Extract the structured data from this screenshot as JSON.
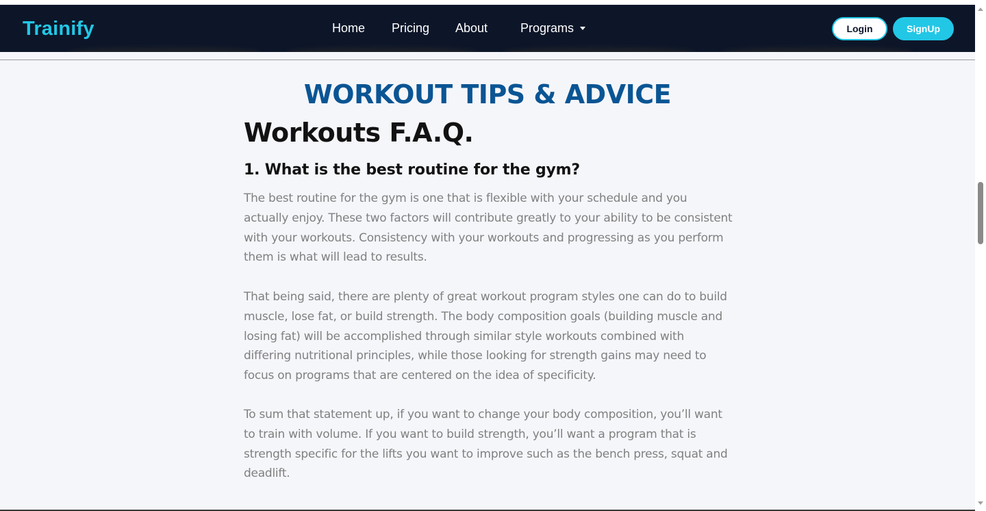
{
  "navbar": {
    "brand": "Trainify",
    "links": [
      {
        "label": "Home"
      },
      {
        "label": "Pricing"
      },
      {
        "label": "About"
      },
      {
        "label": "Programs"
      }
    ],
    "login_label": "Login",
    "signup_label": "SignUp"
  },
  "colors": {
    "brand": "#22c7e6",
    "navbar_bg": "#0d1629",
    "heading": "#0a5594",
    "page_bg": "#f5f6fa",
    "body_text": "#808080"
  },
  "main": {
    "page_heading": "WORKOUT TIPS & ADVICE",
    "faq_title": "Workouts F.A.Q.",
    "question": "1. What is the best routine for the gym?",
    "paragraphs": [
      "The best routine for the gym is one that is flexible with your schedule and you actually enjoy. These two factors will contribute greatly to your ability to be consistent with your workouts. Consistency with your workouts and progressing as you perform them is what will lead to results.",
      "That being said, there are plenty of great workout program styles one can do to build muscle, lose fat, or build strength. The body composition goals (building muscle and losing fat) will be accomplished through similar style workouts combined with differing nutritional principles, while those looking for strength gains may need to focus on programs that are centered on the idea of specificity.",
      "To sum that statement up, if you want to change your body composition, you’ll want to train with volume. If you want to build strength, you’ll want a program that is strength specific for the lifts you want to improve such as the bench press, squat and deadlift."
    ]
  }
}
